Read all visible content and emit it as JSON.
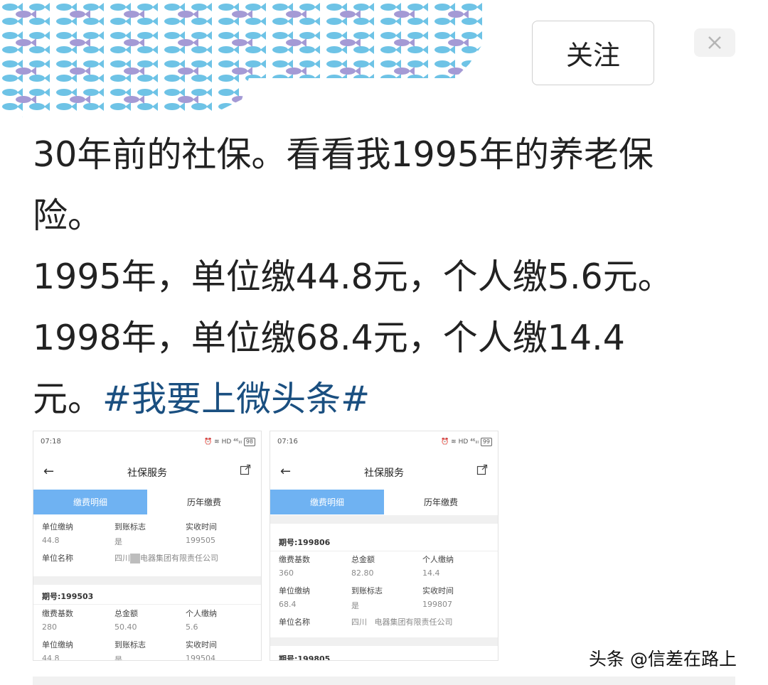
{
  "header": {
    "follow_label": "关注",
    "close_icon": "close-icon"
  },
  "post": {
    "line1": "30年前的社保。看看我1995年的养老保",
    "line2": "险。",
    "line3": "1995年，单位缴44.8元，个人缴5.6元。",
    "line4": "1998年，单位缴68.4元，个人缴14.4",
    "line5": "元。",
    "hashtag": "#我要上微头条#"
  },
  "shot1": {
    "time": "07:18",
    "status": "HD ⁴⁶ᵢₗₗ",
    "battery": "98",
    "title": "社保服务",
    "tab_active": "缴费明细",
    "tab_inactive": "历年缴费",
    "top": {
      "l1": "单位缴纳",
      "v1": "44.8",
      "l2": "到账标志",
      "v2": "是",
      "l3": "实收时间",
      "v3": "199505",
      "name_label": "单位名称",
      "name_a": "四川",
      "name_b": "电器集团有限责任公司"
    },
    "period": "期号:199503",
    "r1": {
      "l1": "缴费基数",
      "v1": "280",
      "l2": "总金额",
      "v2": "50.40",
      "l3": "个人缴纳",
      "v3": "5.6"
    },
    "r2": {
      "l1": "单位缴纳",
      "v1": "44.8",
      "l2": "到账标志",
      "v2": "是",
      "l3": "实收时间",
      "v3": "199504"
    }
  },
  "shot2": {
    "time": "07:16",
    "status": "HD ⁴⁶ᵢₗₗ",
    "battery": "99",
    "title": "社保服务",
    "tab_active": "缴费明细",
    "tab_inactive": "历年缴费",
    "period": "期号:199806",
    "r1": {
      "l1": "缴费基数",
      "v1": "360",
      "l2": "总金额",
      "v2": "82.80",
      "l3": "个人缴纳",
      "v3": "14.4"
    },
    "r2": {
      "l1": "单位缴纳",
      "v1": "68.4",
      "l2": "到账标志",
      "v2": "是",
      "l3": "实收时间",
      "v3": "199807"
    },
    "name_label": "单位名称",
    "name_a": "四川",
    "name_b": "电器集团有限责任公司",
    "period_next": "期号:199805"
  },
  "watermark": "头条 @信差在路上"
}
